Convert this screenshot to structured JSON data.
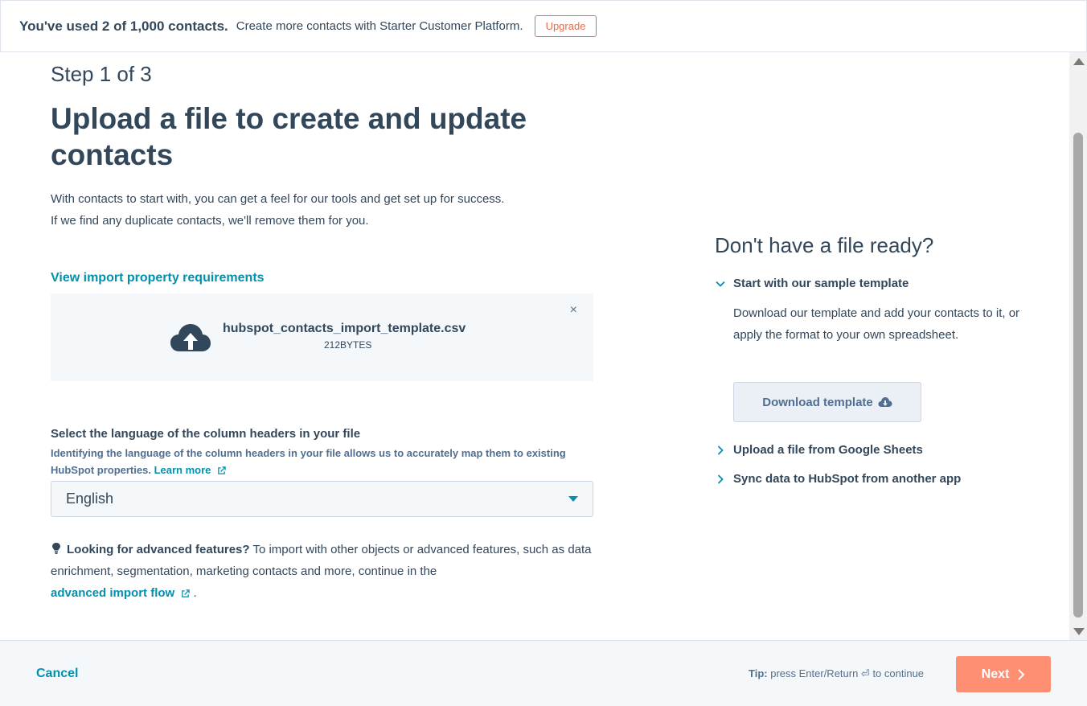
{
  "banner": {
    "title": "You've used 2 of 1,000 contacts.",
    "text": "Create more contacts with Starter Customer Platform.",
    "upgrade_label": "Upgrade"
  },
  "main": {
    "step": "Step 1 of 3",
    "title": "Upload a file to create and update contacts",
    "desc_line1": "With contacts to start with, you can get a feel for our tools and get set up for success.",
    "desc_line2": "If we find any duplicate contacts, we'll remove them for you.",
    "requirements_link": "View import property requirements",
    "file": {
      "name": "hubspot_contacts_import_template.csv",
      "size": "212BYTES",
      "close_glyph": "×"
    },
    "language": {
      "label": "Select the language of the column headers in your file",
      "help": "Identifying the language of the column headers in your file allows us to accurately map them to existing HubSpot properties.",
      "learn_more": "Learn more",
      "selected": "English"
    },
    "advanced": {
      "bold": "Looking for advanced features?",
      "text": "To import with other objects or advanced features, such as data enrichment, segmentation, marketing contacts and more, continue in the",
      "link": "advanced import flow",
      "end": "."
    }
  },
  "side": {
    "title": "Don't have a file ready?",
    "sample_template": "Start with our sample template",
    "sample_body": "Download our template and add your contacts to it, or apply the format to your own spreadsheet.",
    "download_label": "Download template",
    "google_sheets": "Upload a file from Google Sheets",
    "sync_app": "Sync data to HubSpot from another app"
  },
  "footer": {
    "cancel_label": "Cancel",
    "tip_bold": "Tip:",
    "tip_text": "press Enter/Return ⏎ to continue",
    "next_label": "Next"
  },
  "colors": {
    "teal_link": "#0091ae",
    "next_button": "#ff8f73",
    "upgrade": "#e46e51",
    "text": "#33475b"
  }
}
